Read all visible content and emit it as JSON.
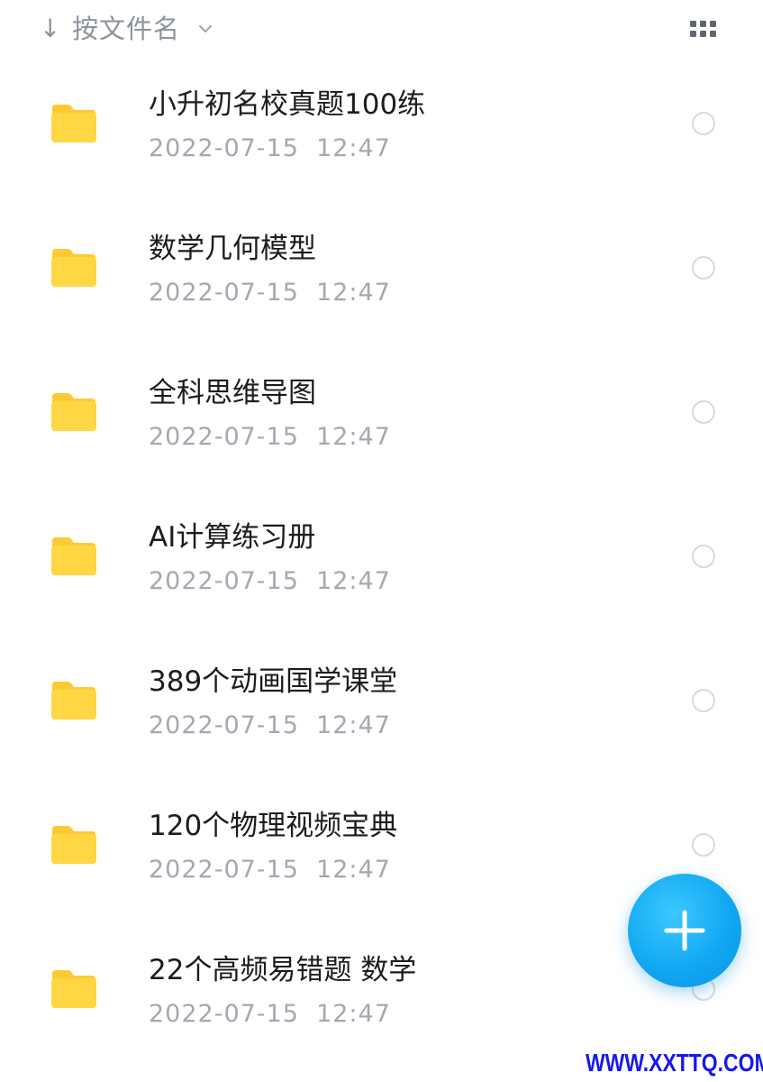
{
  "sort_bar": {
    "arrow": "↓",
    "label": "按文件名",
    "chevron_icon": "chevron-down-icon",
    "view_toggle_icon": "grid-view-icon"
  },
  "files": [
    {
      "name": "小升初名校真题100练",
      "date": "2022-07-15  12:47"
    },
    {
      "name": "数学几何模型",
      "date": "2022-07-15  12:47"
    },
    {
      "name": "全科思维导图",
      "date": "2022-07-15  12:47"
    },
    {
      "name": "AI计算练习册",
      "date": "2022-07-15  12:47"
    },
    {
      "name": "389个动画国学课堂",
      "date": "2022-07-15  12:47"
    },
    {
      "name": "120个物理视频宝典",
      "date": "2022-07-15  12:47"
    },
    {
      "name": "22个高频易错题 数学",
      "date": "2022-07-15  12:47"
    }
  ],
  "fab": {
    "icon": "plus-icon"
  },
  "watermark": "WWW.XXTTQ.COM",
  "colors": {
    "folder": "#FFD644",
    "folder_tab": "#FFC933",
    "fab": "#12A8F2",
    "secondary_text": "#A3A8B1",
    "watermark": "#1717EE"
  }
}
